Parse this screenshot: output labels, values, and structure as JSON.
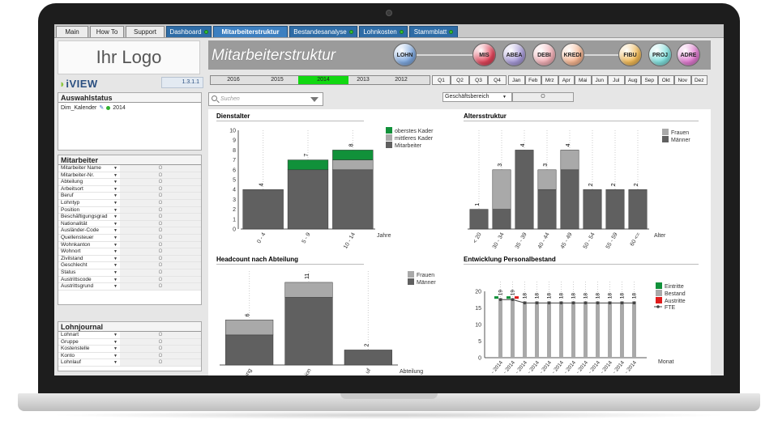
{
  "tabs": [
    {
      "label": "Main",
      "style": "plain"
    },
    {
      "label": "How To",
      "style": "plain"
    },
    {
      "label": "Support",
      "style": "plain"
    },
    {
      "label": "Dashboard",
      "style": "blue"
    },
    {
      "label": "Mitarbeiterstruktur",
      "style": "active"
    },
    {
      "label": "Bestandesanalyse",
      "style": "blue"
    },
    {
      "label": "Lohnkosten",
      "style": "blue"
    },
    {
      "label": "Stammblatt",
      "style": "blue"
    }
  ],
  "logo_text": "Ihr Logo",
  "brand": "iVIEW",
  "version": "1.3.1.1",
  "auswahlstatus": {
    "title": "Auswahlstatus",
    "field": "Dim_Kalender",
    "value": "2014"
  },
  "mitarbeiter": {
    "title": "Mitarbeiter",
    "items": [
      "Mitarbeiter Name",
      "Mitarbeiter-Nr.",
      "Abteilung",
      "Arbeitsort",
      "Beruf",
      "Lohntyp",
      "Position",
      "Beschäftigungsgrad",
      "Nationalität",
      "Ausländer-Code",
      "Quellensteuer",
      "Wohnkanton",
      "Wohnort",
      "Zivilstand",
      "Geschlecht",
      "Status",
      "Austrittscode",
      "Austrittsgrund"
    ]
  },
  "lohnjournal": {
    "title": "Lohnjournal",
    "items": [
      "Lohnart",
      "Gruppe",
      "Kostenstelle",
      "Konto",
      "Lohnlauf"
    ]
  },
  "page_title": "Mitarbeiterstruktur",
  "modules": [
    {
      "label": "LOHN",
      "color": "#7fa9e0"
    },
    {
      "label": "MIS",
      "color": "#e0455a"
    },
    {
      "label": "ABEA",
      "color": "#a79ad8"
    },
    {
      "label": "DEBI",
      "color": "#f3b0b7"
    },
    {
      "label": "KREDI",
      "color": "#f6b590"
    },
    {
      "label": "FIBU",
      "color": "#f1b955"
    },
    {
      "label": "PROJ",
      "color": "#7fe0dd"
    },
    {
      "label": "ADRE",
      "color": "#e07ad0"
    }
  ],
  "years": [
    "2016",
    "2015",
    "2014",
    "2013",
    "2012"
  ],
  "selected_year": "2014",
  "quarters": [
    "Q1",
    "Q2",
    "Q3",
    "Q4"
  ],
  "months": [
    "Jan",
    "Feb",
    "Mrz",
    "Apr",
    "Mai",
    "Jun",
    "Jul",
    "Aug",
    "Sep",
    "Okt",
    "Nov",
    "Dez"
  ],
  "search_placeholder": "Suchen",
  "geschaeftsbereich": {
    "label": "Geschäftsbereich",
    "value": "O"
  },
  "list_value": "O",
  "colors": {
    "dark": "#606060",
    "light": "#a9a9a9",
    "green": "#11913a",
    "red": "#e01b1b"
  },
  "chart_data": [
    {
      "type": "bar",
      "title": "Dienstalter",
      "xlabel": "Jahre",
      "ylim": [
        0,
        10
      ],
      "yticks": [
        0,
        1,
        2,
        3,
        4,
        5,
        6,
        7,
        8,
        9,
        10
      ],
      "categories": [
        "0 - 4",
        "5 - 9",
        "10 - 14"
      ],
      "series": [
        {
          "name": "Mitarbeiter",
          "values": [
            4,
            6,
            6
          ]
        },
        {
          "name": "mittleres Kader",
          "values": [
            0,
            0,
            1
          ]
        },
        {
          "name": "oberstes Kader",
          "values": [
            0,
            1,
            1
          ]
        }
      ],
      "totals": [
        "4",
        "7",
        "8"
      ]
    },
    {
      "type": "bar",
      "title": "Altersstruktur",
      "xlabel": "Alter",
      "categories": [
        "< 20",
        "30 - 34",
        "35 - 39",
        "40 - 44",
        "45 - 49",
        "50 - 54",
        "55 - 59",
        "60 <="
      ],
      "series": [
        {
          "name": "Männer",
          "values": [
            1,
            1,
            4,
            2,
            3,
            2,
            2,
            2
          ]
        },
        {
          "name": "Frauen",
          "values": [
            0,
            2,
            0,
            1,
            1,
            0,
            0,
            0
          ]
        }
      ],
      "totals": [
        "1",
        "3",
        "4",
        "3",
        "4",
        "2",
        "2",
        "2"
      ]
    },
    {
      "type": "bar",
      "title": "Headcount nach Abteilung",
      "xlabel": "Abteilung",
      "categories": [
        "ung",
        "ion",
        "uf"
      ],
      "series": [
        {
          "name": "Männer",
          "values": [
            4,
            9,
            2
          ]
        },
        {
          "name": "Frauen",
          "values": [
            2,
            2,
            0
          ]
        }
      ],
      "totals": [
        "6",
        "11",
        "2"
      ]
    },
    {
      "type": "bar",
      "title": "Entwicklung Personalbestand",
      "xlabel": "Monat",
      "ylim": [
        0,
        20
      ],
      "yticks": [
        0,
        5,
        10,
        15,
        20
      ],
      "categories": [
        "- 2014",
        "- 2014",
        "- 2014",
        "- 2014",
        "- 2014",
        "- 2014",
        "- 2014",
        "- 2014",
        "- 2014",
        "- 2014",
        "- 2014",
        "- 2014"
      ],
      "series": [
        {
          "name": "Bestand",
          "values": [
            18,
            18,
            17,
            17,
            17,
            17,
            17,
            17,
            17,
            17,
            17,
            17
          ]
        },
        {
          "name": "Eintritte",
          "values": [
            1,
            1,
            0,
            0,
            0,
            0,
            0,
            0,
            0,
            0,
            0,
            0
          ]
        },
        {
          "name": "Austritte",
          "values": [
            0,
            1,
            0,
            0,
            0,
            0,
            0,
            0,
            0,
            0,
            0,
            0
          ]
        },
        {
          "name": "FTE",
          "values": [
            17.5,
            17.5,
            16.5,
            16.5,
            16.5,
            16.5,
            16.5,
            16.5,
            16.5,
            16.5,
            16.5,
            16.5
          ]
        }
      ],
      "totals": [
        "19",
        "19",
        "18",
        "18",
        "18",
        "18",
        "18",
        "18",
        "18",
        "18",
        "18",
        "18"
      ]
    }
  ]
}
